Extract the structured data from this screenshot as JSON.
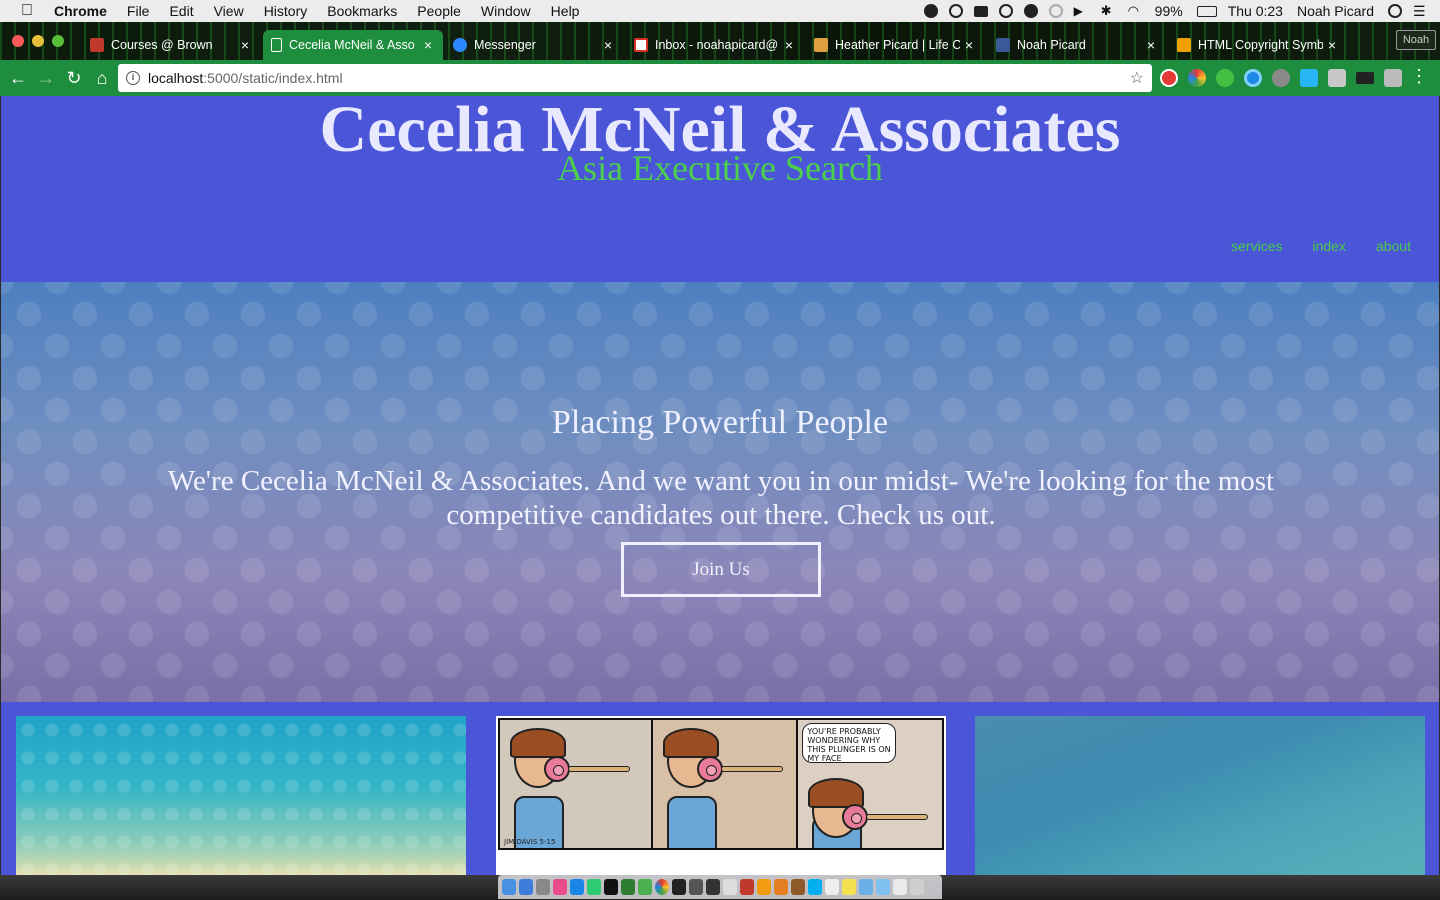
{
  "menubar": {
    "apple": "",
    "app_name": "Chrome",
    "items": [
      "File",
      "Edit",
      "View",
      "History",
      "Bookmarks",
      "People",
      "Window",
      "Help"
    ],
    "battery": "99%",
    "clock": "Thu 0:23",
    "user": "Noah Picard"
  },
  "tabs": [
    {
      "title": "Courses @ Brown",
      "favicon_color": "#c0392b"
    },
    {
      "title": "Cecelia McNeil & Asso",
      "favicon_color": "#ffffff"
    },
    {
      "title": "Messenger",
      "favicon_color": "#2d88ff"
    },
    {
      "title": "Inbox - noahapicard@",
      "favicon_color": "#d93025"
    },
    {
      "title": "Heather Picard | Life C",
      "favicon_color": "#e0a040"
    },
    {
      "title": "Noah Picard",
      "favicon_color": "#3b5998"
    },
    {
      "title": "HTML Copyright Symb",
      "favicon_color": "#f0a000"
    }
  ],
  "profile_label": "Noah",
  "address": {
    "host": "localhost",
    "path": ":5000/static/index.html"
  },
  "site": {
    "brand": "Cecelia McNeil & Associates",
    "tagline": "Asia Executive Search",
    "nav": [
      "services",
      "index",
      "about"
    ],
    "hero_heading": "Placing Powerful People",
    "hero_text": "We're Cecelia McNeil & Associates. And we want you in our midst- We're looking for the most competitive candidates out there. Check us out.",
    "cta": "Join Us"
  },
  "comic": {
    "bubble": "YOU'RE PROBABLY WONDERING WHY THIS PLUNGER IS ON MY FACE",
    "signature": "JIM DAVIS 5-15"
  },
  "colors": {
    "page_bg": "#4a55d8",
    "accent_green": "#4ccc4c",
    "toolbar_green": "#1e8e3e"
  }
}
